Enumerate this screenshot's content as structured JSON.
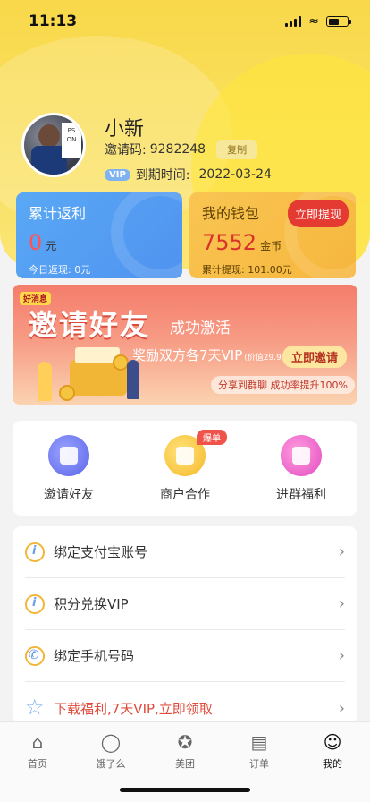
{
  "status_bar": {
    "time": "11:13"
  },
  "profile": {
    "name": "小新",
    "invite_label": "邀请码:",
    "invite_code": "9282248",
    "copy_label": "复制",
    "vip_badge": "VIP",
    "expire_label": "到期时间:",
    "expire_date": "2022-03-24",
    "avatar_sign_text": "PS\nON"
  },
  "rebate_card": {
    "title": "累计返利",
    "value": "0",
    "unit": "元",
    "sub": "今日返现: 0元"
  },
  "wallet_card": {
    "title": "我的钱包",
    "value": "7552",
    "unit": "金币",
    "sub": "累计提现: 101.00元",
    "withdraw_label": "立即提现"
  },
  "banner": {
    "tag": "好消息",
    "title": "邀请好友",
    "subtitle": "成功激活",
    "reward": "奖励双方各7天VIP",
    "reward_price": "(价值29.9元)",
    "invite_button": "立即邀请",
    "share_text": "分享到群聊 成功率提升100%"
  },
  "quick_actions": [
    {
      "label": "邀请好友",
      "icon": "invite-friends-icon"
    },
    {
      "label": "商户合作",
      "icon": "merchant-icon",
      "badge": "爆单"
    },
    {
      "label": "进群福利",
      "icon": "group-gift-icon"
    }
  ],
  "list_items": [
    {
      "label": "绑定支付宝账号",
      "icon": "info-icon"
    },
    {
      "label": "积分兑换VIP",
      "icon": "info-icon"
    },
    {
      "label": "绑定手机号码",
      "icon": "phone-icon"
    },
    {
      "label": "下载福利,7天VIP,立即领取",
      "icon": "star-icon"
    }
  ],
  "tabs": [
    {
      "label": "首页",
      "icon": "home-icon"
    },
    {
      "label": "饿了么",
      "icon": "eleme-icon"
    },
    {
      "label": "美团",
      "icon": "meituan-icon"
    },
    {
      "label": "订单",
      "icon": "order-icon"
    },
    {
      "label": "我的",
      "icon": "profile-icon",
      "active": true
    }
  ]
}
